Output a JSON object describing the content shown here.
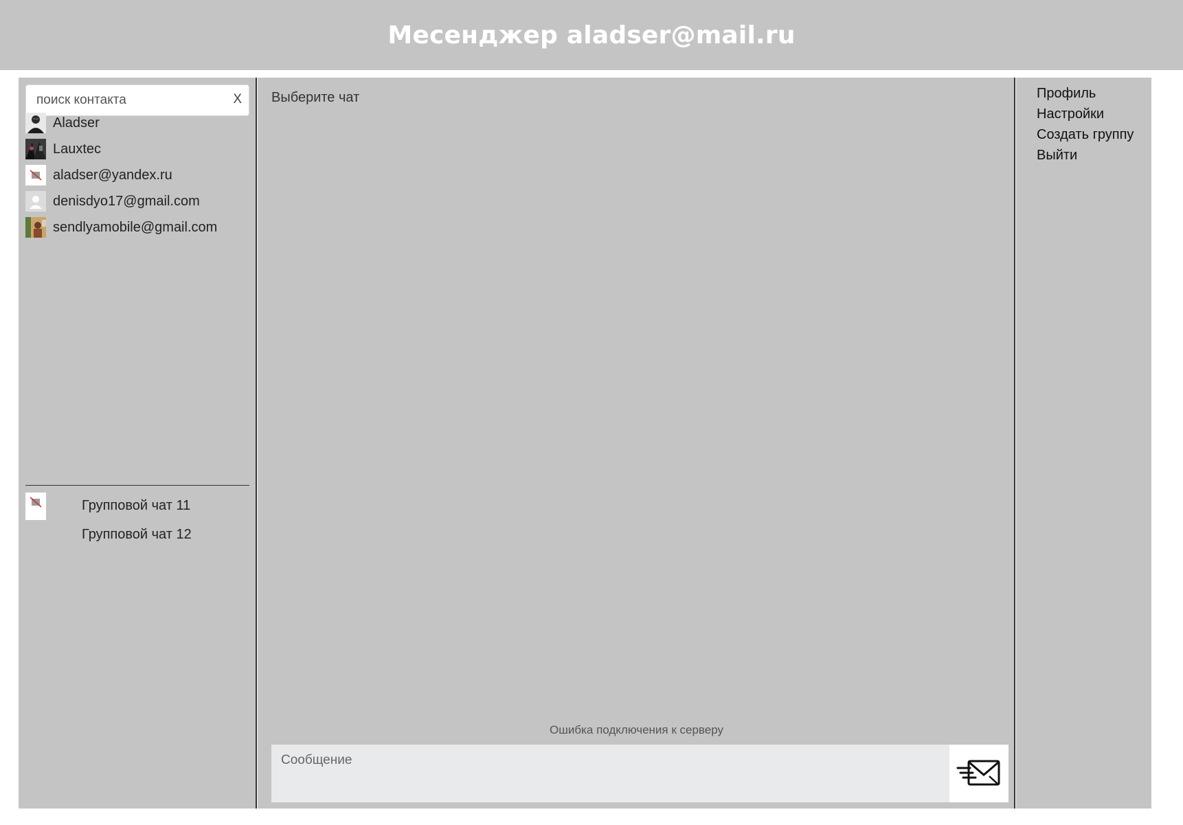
{
  "header": {
    "title": "Месенджер aladser@mail.ru"
  },
  "search": {
    "placeholder": "поиск контакта",
    "value": "",
    "clear_label": "X"
  },
  "contacts": [
    {
      "name": "Aladser",
      "avatar": "photo-avatar"
    },
    {
      "name": "Lauxtec",
      "avatar": "photo-avatar"
    },
    {
      "name": "aladser@yandex.ru",
      "avatar": "broken-image-icon"
    },
    {
      "name": "denisdyo17@gmail.com",
      "avatar": "default-user-icon"
    },
    {
      "name": "sendlyamobile@gmail.com",
      "avatar": "photo-avatar"
    }
  ],
  "groups": [
    {
      "name": "Групповой чат 11",
      "avatar": "broken-image-icon"
    },
    {
      "name": "Групповой чат 12",
      "avatar": ""
    }
  ],
  "chat": {
    "placeholder_text": "Выберите чат",
    "status_text": "Ошибка подключения к серверу",
    "message_placeholder": "Сообщение",
    "send_icon": "send-envelope-icon"
  },
  "menu": {
    "items": [
      "Профиль",
      "Настройки",
      "Создать группу",
      "Выйти"
    ]
  },
  "colors": {
    "panel_bg": "#c4c4c4",
    "header_text": "#ffffff",
    "composer_bg": "#e8eaec"
  }
}
